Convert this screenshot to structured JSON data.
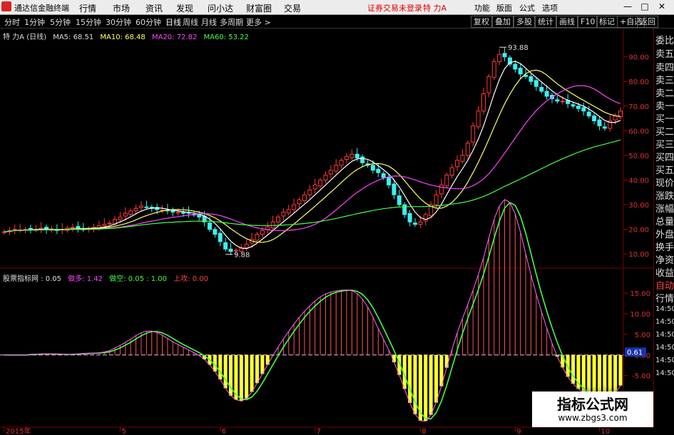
{
  "app": {
    "title": "通达信金融终端"
  },
  "menu": [
    "行情",
    "市场",
    "资讯",
    "发现",
    "问小达",
    "财富圈",
    "交易"
  ],
  "status_text": "证券交易未登录",
  "stock_name_top": "特 力A",
  "right_menu": [
    "功能",
    "版面",
    "公式",
    "选项"
  ],
  "window_buttons": [
    "—",
    "□",
    "✕"
  ],
  "periods": [
    "分时",
    "1分钟",
    "5分钟",
    "15分钟",
    "30分钟",
    "60分钟",
    "日线",
    "周线",
    "月线",
    "多周期",
    "更多 >"
  ],
  "active_period": "日线",
  "tools": [
    "复权",
    "叠加",
    "多股",
    "统计",
    "画线",
    "F10",
    "标记",
    "+自选",
    "返回"
  ],
  "right_panel": [
    "委比",
    "卖五",
    "卖四",
    "卖三",
    "卖二",
    "卖一",
    "买一",
    "买二",
    "买三",
    "买四",
    "买五",
    "现价",
    "涨跌",
    "涨幅",
    "总量",
    "外盘",
    "换手",
    "净资",
    "收益"
  ],
  "right_panel2": [
    "自动",
    "行情"
  ],
  "right_time": [
    "14:50",
    "14:50",
    "14:50",
    "14:50",
    "14:50",
    "14:50"
  ],
  "ma_legend": {
    "title": "特 力A (日线)",
    "ma5": "MA5: 68.51",
    "ma10": "MA10: 68.48",
    "ma20": "MA20: 72.82",
    "ma60": "MA60: 53.22",
    "colors": {
      "ma5": "#ffffff",
      "ma10": "#ffff66",
      "ma20": "#ff44ff",
      "ma60": "#44ff44"
    }
  },
  "ind_legend": {
    "name": "股票指标网",
    "value": ": 0.05",
    "long_label": "做多: 1.42",
    "short_label": "做空: 0.05 : 1.00",
    "up_label": "上攻: 0.00"
  },
  "watermark": {
    "line1": "指标公式网",
    "line2": "www.zbgs3.com"
  },
  "chart_data": [
    {
      "type": "candlestick",
      "title": "特 力A (日线)",
      "y_ticks": [
        10,
        20,
        30,
        40,
        50,
        60,
        70,
        80,
        90
      ],
      "ylim": [
        6,
        98
      ],
      "x_months": [
        "2015年",
        "5",
        "6",
        "7",
        "8",
        "9",
        "10"
      ],
      "annotations": [
        {
          "label": "93.88",
          "value": 93.88
        },
        {
          "label": "9.88",
          "value": 9.88
        }
      ],
      "close": [
        19,
        19.5,
        20,
        19.8,
        20,
        20.2,
        19.8,
        20.5,
        20,
        20,
        19.5,
        20,
        20.5,
        20.8,
        20.5,
        20,
        20.2,
        20.8,
        21.5,
        22,
        22.5,
        24,
        25,
        26.5,
        27.5,
        28.5,
        29.5,
        29,
        28.5,
        28,
        27.8,
        27.5,
        27,
        27,
        26.5,
        26.5,
        26,
        25,
        23,
        20,
        18,
        15,
        12,
        11,
        11.5,
        12.5,
        14,
        16,
        18,
        19.5,
        21,
        23,
        25,
        27,
        28,
        30,
        32,
        34,
        36,
        38,
        40,
        42,
        44,
        46,
        48,
        49.5,
        50.5,
        49,
        47,
        46,
        44,
        43,
        41,
        38,
        34,
        30,
        26,
        23,
        22,
        23,
        26,
        30,
        34,
        38,
        42,
        45,
        48,
        50,
        55,
        62,
        68,
        75,
        82,
        88,
        91,
        90,
        87,
        85,
        83,
        82,
        80,
        78,
        76,
        74,
        73,
        72,
        72,
        71,
        70,
        69,
        68,
        66,
        64,
        62,
        61,
        64,
        66,
        68
      ]
    },
    {
      "type": "indicator",
      "name": "股票指标网",
      "y_ticks": [
        15,
        10,
        5,
        0,
        -5
      ],
      "ylim": [
        -17,
        19
      ],
      "current_value": "0.61"
    }
  ]
}
